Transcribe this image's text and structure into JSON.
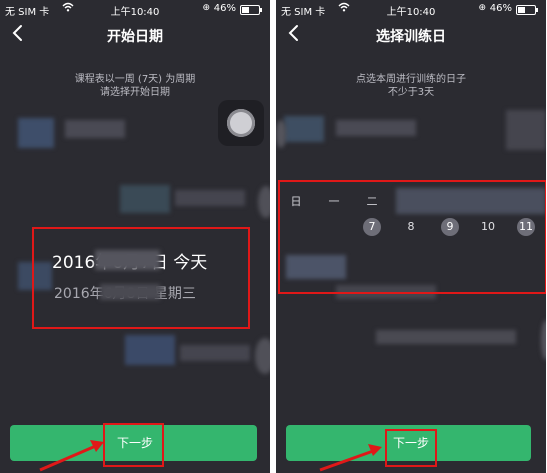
{
  "status_bar": {
    "carrier": "无 SIM 卡",
    "time": "上午10:40",
    "battery": "46%",
    "wifi_icon": "wifi-icon",
    "lock_icon": "rotation-lock-icon",
    "battery_icon": "battery-icon"
  },
  "left": {
    "title": "开始日期",
    "hint_line1": "课程表以一周 (7天) 为周期",
    "hint_line2": "请选择开始日期",
    "date_main": "2016年6月7日  今天",
    "date_sub": "2016年6月8日  星期三",
    "next_label": "下一步"
  },
  "right": {
    "title": "选择训练日",
    "hint_line1": "点选本周进行训练的日子",
    "hint_line2": "不少于3天",
    "weekdays": [
      "日",
      "一",
      "二"
    ],
    "days": [
      "7",
      "8",
      "9",
      "10",
      "11"
    ],
    "next_label": "下一步"
  },
  "colors": {
    "background": "#2b2b31",
    "accent": "#34b66e",
    "annotation": "#e01818"
  }
}
